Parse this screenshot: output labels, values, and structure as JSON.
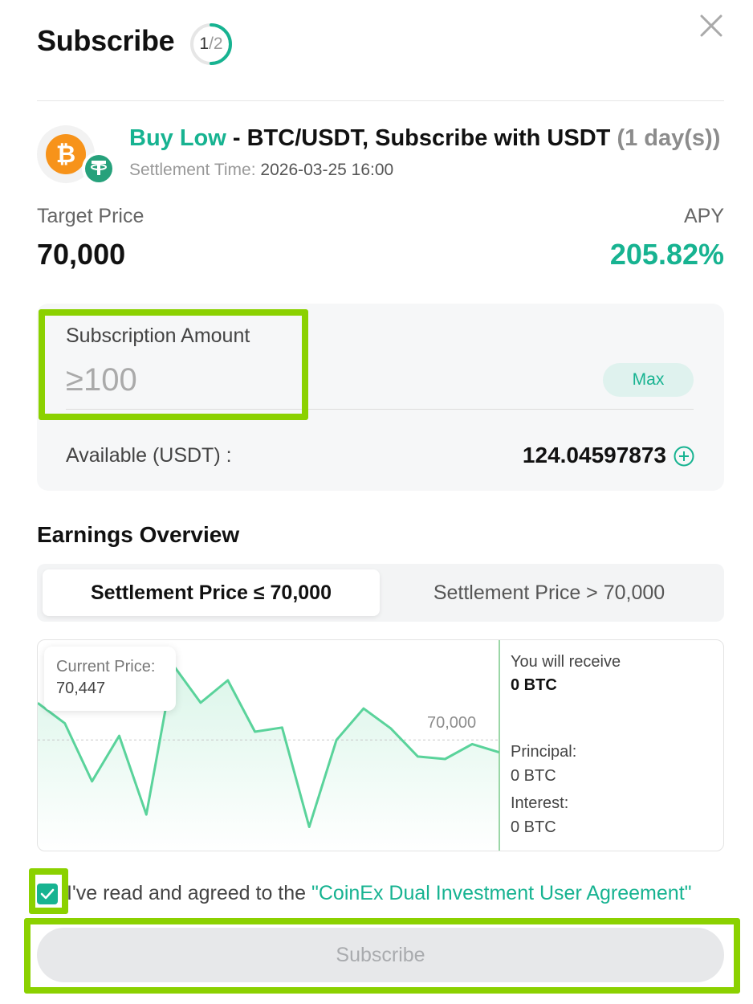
{
  "header": {
    "title": "Subscribe",
    "step_current": "1",
    "step_total": "/2",
    "step_progress": 0.5,
    "close_icon": "close-icon"
  },
  "product": {
    "strategy": "Buy Low",
    "pair_text": " - BTC/USDT, Subscribe with USDT ",
    "duration": "(1 day(s))",
    "settlement_label": "Settlement Time:",
    "settlement_value": "2026-03-25 16:00",
    "base_coin_icon": "bitcoin-icon",
    "quote_coin_icon": "tether-icon"
  },
  "pricing": {
    "target_label": "Target Price",
    "target_value": "70,000",
    "apy_label": "APY",
    "apy_value": "205.82%"
  },
  "amount": {
    "label": "Subscription Amount",
    "value": "",
    "placeholder": "≥100",
    "max_label": "Max",
    "available_label": "Available (USDT) :",
    "available_value": "124.04597873"
  },
  "earnings": {
    "title": "Earnings Overview",
    "tabs": [
      {
        "label": "Settlement Price ≤ 70,000",
        "active": true
      },
      {
        "label": "Settlement Price > 70,000",
        "active": false
      }
    ],
    "current_price_label": "Current Price:",
    "current_price_value": "70,447",
    "strike_label": "70,000",
    "receive_label": "You will receive",
    "receive_value": "0 BTC",
    "principal_label": "Principal:",
    "principal_value": "0 BTC",
    "interest_label": "Interest:",
    "interest_value": "0 BTC"
  },
  "chart_data": {
    "type": "line",
    "series": [
      {
        "values": [
          70447,
          70200,
          69500,
          70050,
          69100,
          70900,
          70450,
          70720,
          70100,
          70150,
          68950,
          70000,
          70380,
          70140,
          69800,
          69770,
          69950,
          69850
        ]
      }
    ],
    "reference_line": 70000
  },
  "agreement": {
    "prefix": "I've read and agreed to the ",
    "link": "\"CoinEx Dual Investment User Agreement\"",
    "checked": true
  },
  "submit": {
    "label": "Subscribe"
  },
  "colors": {
    "accent": "#17b391",
    "highlight": "#8bd100",
    "bitcoin": "#f7931a",
    "tether": "#26a17b",
    "button_disabled_bg": "#e7e8ea"
  }
}
